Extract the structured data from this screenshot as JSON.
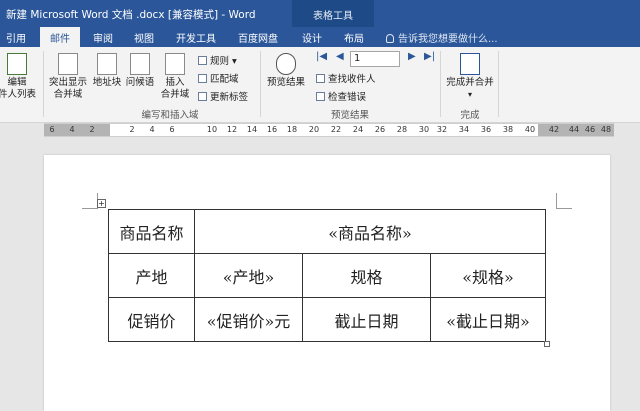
{
  "titlebar": {
    "title": "新建 Microsoft Word 文档 .docx [兼容模式] - Word",
    "context_tab": "表格工具"
  },
  "tabs": [
    "引用",
    "邮件",
    "审阅",
    "视图",
    "开发工具",
    "百度网盘",
    "设计",
    "布局"
  ],
  "active_tab": "邮件",
  "tell_me": "告诉我您想要做什么...",
  "ribbon": {
    "edit_recipients": "编辑\n件人列表",
    "highlight_merge": "突出显示\n合并域",
    "address_block": "地址块",
    "greeting_line": "问候语",
    "insert_merge_field": "插入\n合并域",
    "rules": "规则",
    "match_fields": "匹配域",
    "update_labels": "更新标签",
    "group_write_insert": "编写和插入域",
    "preview_results": "预览结果",
    "record_number": "1",
    "find_recipient": "查找收件人",
    "check_errors": "检查错误",
    "group_preview": "预览结果",
    "finish_merge": "完成并合并",
    "group_finish": "完成"
  },
  "ruler": [
    "6",
    "4",
    "2",
    "2",
    "4",
    "6",
    "10",
    "12",
    "14",
    "16",
    "18",
    "20",
    "22",
    "24",
    "26",
    "28",
    "30",
    "32",
    "34",
    "36",
    "38",
    "40",
    "42",
    "44",
    "46",
    "48"
  ],
  "table": {
    "row1": [
      "商品名称",
      "«商品名称»"
    ],
    "row2": [
      "产地",
      "«产地»",
      "规格",
      "«规格»"
    ],
    "row3": [
      "促销价",
      "«促销价»元",
      "截止日期",
      "«截止日期»"
    ]
  },
  "colors": {
    "accent": "#2b579a",
    "context_tab": "#1e4a87"
  }
}
